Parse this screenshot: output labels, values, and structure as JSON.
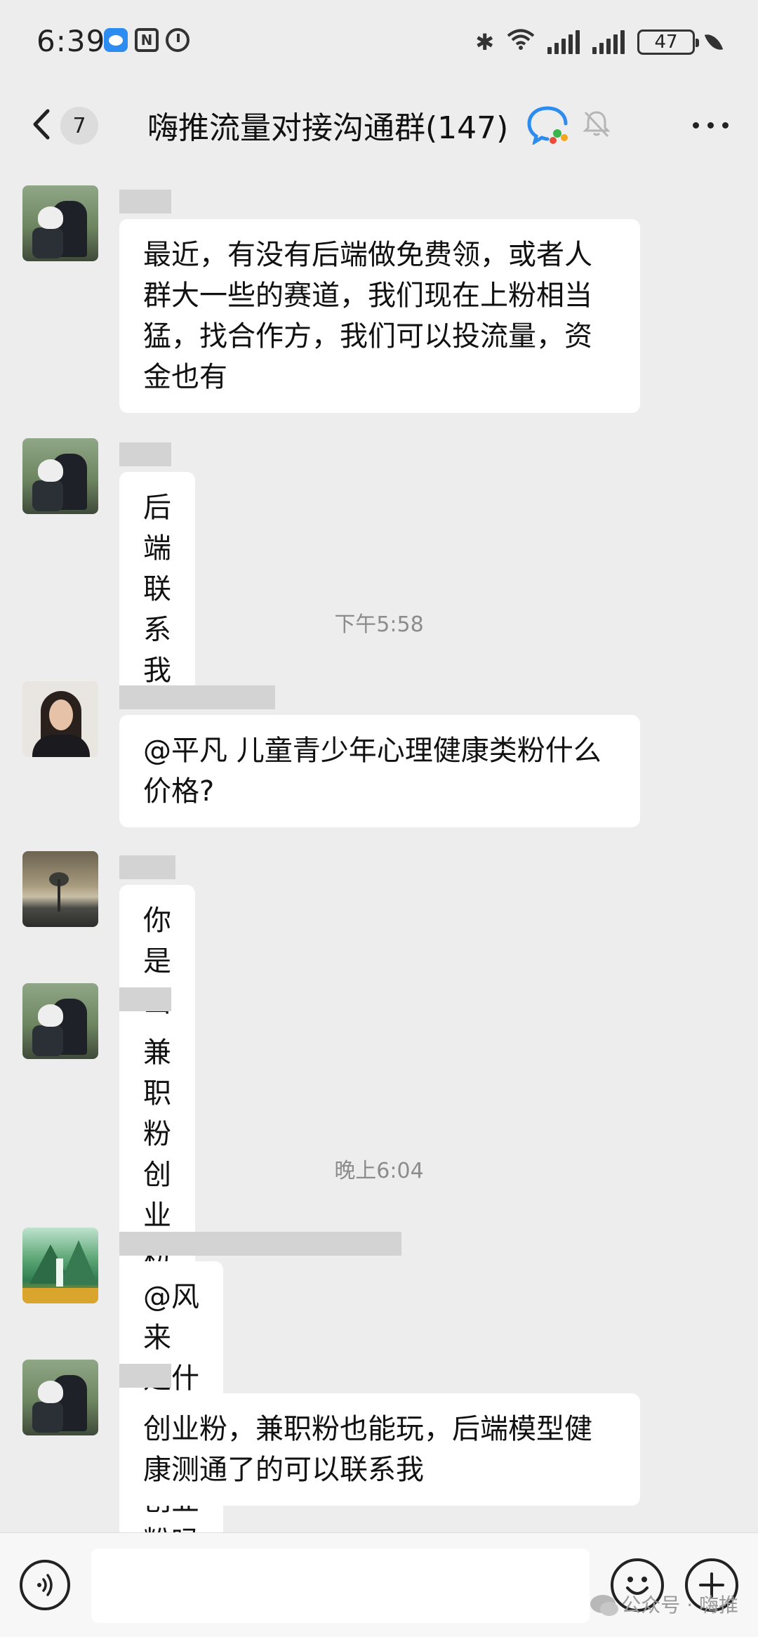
{
  "status_bar": {
    "time": "6:39",
    "battery": "47"
  },
  "header": {
    "unread_count": "7",
    "title": "嗨推流量对接沟通群(147)"
  },
  "timestamps": [
    "下午5:58",
    "晚上6:04"
  ],
  "messages": [
    {
      "text": "最近，有没有后端做免费领，或者人群大一些的赛道，我们现在上粉相当猛，找合作方，我们可以投流量，资金也有"
    },
    {
      "text": "后端联系我"
    },
    {
      "text": "@平凡  儿童青少年心理健康类粉什么价格?"
    },
    {
      "text": "你是出还是收啊"
    },
    {
      "text": "兼职粉创业粉也可以联系我一下"
    },
    {
      "text": "@风来  是什么粉，创业粉吗"
    },
    {
      "text": "创业粉，兼职粉也能玩，后端模型健康测通了的可以联系我"
    }
  ],
  "input": {
    "placeholder": ""
  },
  "watermark": "公众号 · 嗨推",
  "colors": {
    "background": "#ededed",
    "bubble": "#ffffff",
    "timestamp": "#8c8c8c"
  }
}
